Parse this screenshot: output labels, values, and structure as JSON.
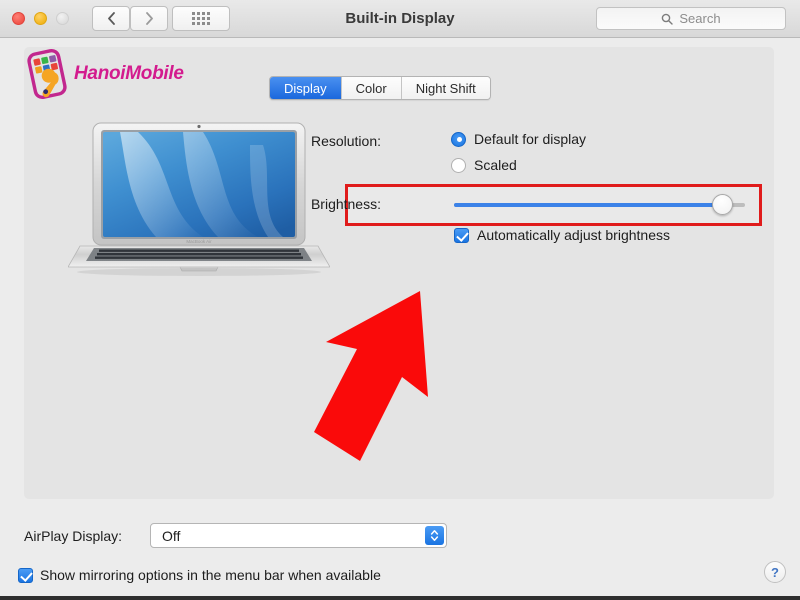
{
  "window": {
    "title": "Built-in Display"
  },
  "titlebar": {
    "traffic": {
      "close": "close-button",
      "minimize": "minimize-button",
      "zoom": "zoom-button"
    },
    "back_icon": "chevron-left-icon",
    "forward_icon": "chevron-right-icon",
    "grid_icon": "grid-view-icon",
    "search": {
      "icon": "search-icon",
      "placeholder": "Search",
      "value": ""
    }
  },
  "watermark": {
    "text": "HanoiMobile",
    "icon": "phone-wrench-logo-icon",
    "color": "#d31b8e"
  },
  "tabs": [
    {
      "label": "Display",
      "active": true
    },
    {
      "label": "Color",
      "active": false
    },
    {
      "label": "Night Shift",
      "active": false
    }
  ],
  "preview": {
    "device_icon": "macbook-air-icon"
  },
  "resolution": {
    "label": "Resolution:",
    "options": [
      {
        "label": "Default for display",
        "selected": true
      },
      {
        "label": "Scaled",
        "selected": false
      }
    ]
  },
  "brightness": {
    "label": "Brightness:",
    "value_percent": 92,
    "highlight_color": "#e01b1b",
    "fill_color": "#3b82e8",
    "auto_adjust": {
      "label": "Automatically adjust brightness",
      "checked": true
    }
  },
  "annotation": {
    "arrow_icon": "red-arrow-icon",
    "color": "#fa0a0a",
    "direction": "up-right"
  },
  "footer": {
    "airplay": {
      "label": "AirPlay Display:",
      "value": "Off",
      "stepper_icon": "up-down-chevron-icon"
    },
    "mirroring": {
      "label": "Show mirroring options in the menu bar when available",
      "checked": true
    },
    "help": {
      "label": "?",
      "icon": "help-icon"
    }
  }
}
